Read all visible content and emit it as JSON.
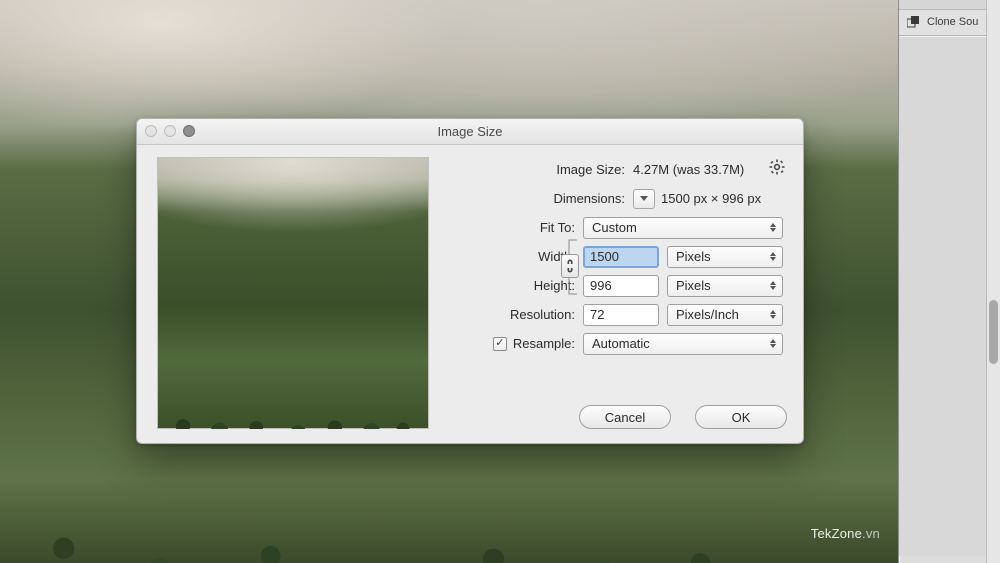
{
  "dialog": {
    "title": "Image Size",
    "info": {
      "image_size_label": "Image Size:",
      "image_size_value": "4.27M (was 33.7M)",
      "dimensions_label": "Dimensions:",
      "dimensions_value": "1500 px  ×  996 px"
    },
    "fit_to": {
      "label": "Fit To:",
      "value": "Custom"
    },
    "width": {
      "label": "Width:",
      "value": "1500",
      "unit": "Pixels"
    },
    "height": {
      "label": "Height:",
      "value": "996",
      "unit": "Pixels"
    },
    "resolution": {
      "label": "Resolution:",
      "value": "72",
      "unit": "Pixels/Inch"
    },
    "resample": {
      "label": "Resample:",
      "checked": true,
      "method": "Automatic"
    },
    "buttons": {
      "cancel": "Cancel",
      "ok": "OK"
    }
  },
  "panels": {
    "clone_source": "Clone Sou"
  },
  "watermark": {
    "brand": "TekZone",
    "tld": ".vn"
  }
}
